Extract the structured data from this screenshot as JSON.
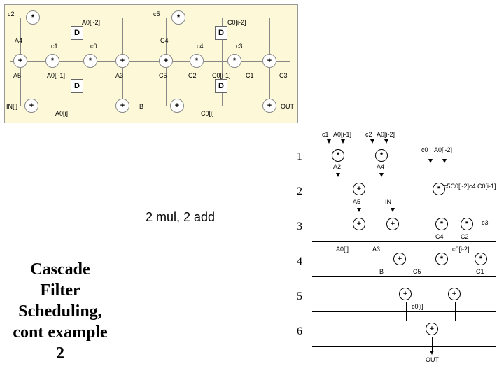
{
  "meta": {
    "title_lines": [
      "Cascade",
      "Filter",
      "Scheduling,",
      "cont example",
      "2"
    ],
    "resource_caption": "2 mul, 2 add"
  },
  "top_dfg": {
    "d_register_label": "D",
    "mul_symbol": "*",
    "add_symbol": "+",
    "row1_inputs_left": {
      "c2": "c2",
      "a4": "A4",
      "c1": "c1",
      "c0": "c0",
      "a0im2": "A0[i-2]"
    },
    "row1_inputs_right": {
      "c5": "c5",
      "c4_lbl": "C4",
      "c4": "c4",
      "c3": "c3",
      "c0im2": "C0[i-2]"
    },
    "row2_labels": {
      "a5": "A5",
      "a0im1": "A0[i-1]",
      "a3": "A3",
      "c5_lbl": "C5",
      "c2_lbl": "C2",
      "c0im1": "C0[i-1]",
      "c1_lbl": "C1",
      "c3_lbl": "C3"
    },
    "row3_labels": {
      "in": "IN[i]",
      "a0i": "A0[i]",
      "b": "B",
      "c0i": "C0[i]",
      "out": "OUT"
    }
  },
  "schedule": {
    "cycles": [
      "1",
      "2",
      "3",
      "4",
      "5",
      "6"
    ],
    "header_signals": {
      "c1": "c1",
      "a0im1": "A0[i-1]",
      "c2": "c2",
      "a0im2": "A0[i-2]",
      "c0": "c0",
      "a0im2r": "A0[i-2]"
    },
    "c1": {
      "left_out": "A2",
      "right_out": "A4"
    },
    "c2": {
      "right_in_seq": "c5C0[i-2]c4  C0[i-1]",
      "left_out": "A5",
      "in_label": "IN"
    },
    "c3": {
      "extra_right": "c3",
      "c4": "C4",
      "c2": "C2"
    },
    "c4": {
      "a0i": "A0[i]",
      "a3": "A3",
      "c0im2": "c0[i-2]",
      "b": "B",
      "c5": "C5",
      "c1": "C1"
    },
    "c5": {
      "c0i": "c0[i]"
    },
    "c6": {
      "out": "OUT"
    }
  }
}
